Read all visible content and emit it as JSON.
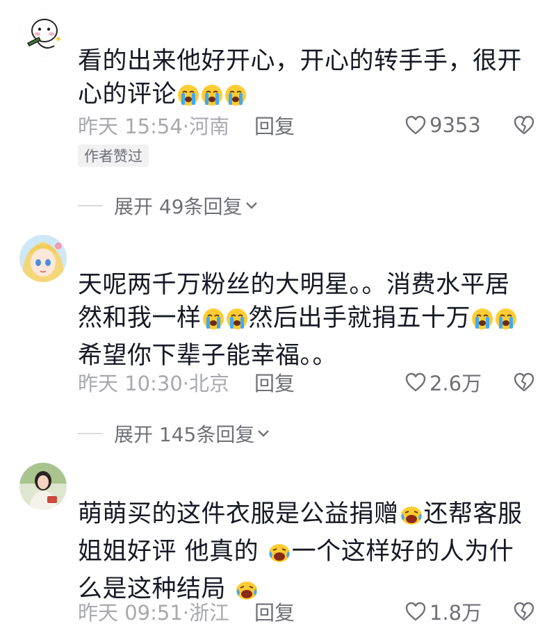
{
  "comments": [
    {
      "text_parts": [
        "看的出来他好开心，开心的转手手，很开心的评论"
      ],
      "trailing_emoji": "cry",
      "trailing_count": 3,
      "time": "昨天 15:54",
      "location": "·河南",
      "reply_label": "回复",
      "likes": "9353",
      "badge": "作者赞过",
      "expand_label": "展开 49条回复"
    },
    {
      "text_parts": [
        "天呢两千万粉丝的大明星。。消费水平居然和我一样",
        "然后出手就捐五十万",
        "希望你下辈子能幸福。。"
      ],
      "time": "昨天 10:30",
      "location": "·北京",
      "reply_label": "回复",
      "likes": "2.6万",
      "expand_label": "展开 145条回复"
    },
    {
      "text_parts": [
        "萌萌买的这件衣服是公益捐赠",
        "还帮客服姐姐好评 他真的 ",
        "一个这样好的人为什么是这种结局 "
      ],
      "time": "昨天 09:51",
      "location": "·浙江",
      "reply_label": "回复",
      "likes": "1.8万"
    }
  ],
  "icons": {
    "like": "heart-outline-icon",
    "dislike": "broken-heart-icon",
    "expand": "chevron-down-icon",
    "emoji_cry": "loudly-crying-face-emoji",
    "emoji_sad": "crying-face-emoji"
  },
  "colors": {
    "text": "#161823",
    "meta": "#a8a9ae",
    "secondary": "#6f7077",
    "badge_bg": "#f1f1f2"
  }
}
